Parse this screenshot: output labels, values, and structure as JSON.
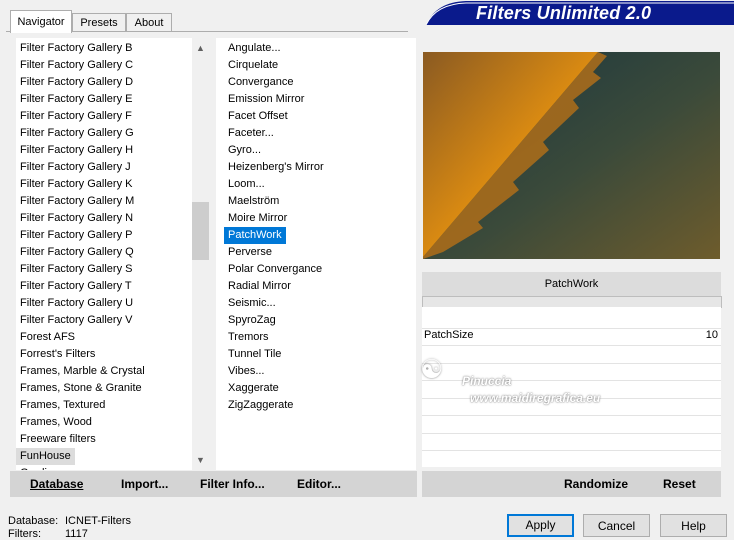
{
  "tabs": [
    "Navigator",
    "Presets",
    "About"
  ],
  "banner_title": "Filters Unlimited 2.0",
  "categories": [
    "Filter Factory Gallery B",
    "Filter Factory Gallery C",
    "Filter Factory Gallery D",
    "Filter Factory Gallery E",
    "Filter Factory Gallery F",
    "Filter Factory Gallery G",
    "Filter Factory Gallery H",
    "Filter Factory Gallery J",
    "Filter Factory Gallery K",
    "Filter Factory Gallery M",
    "Filter Factory Gallery N",
    "Filter Factory Gallery P",
    "Filter Factory Gallery Q",
    "Filter Factory Gallery S",
    "Filter Factory Gallery T",
    "Filter Factory Gallery U",
    "Filter Factory Gallery V",
    "Forest AFS",
    "Forrest's Filters",
    "Frames, Marble & Crystal",
    "Frames, Stone & Granite",
    "Frames, Textured",
    "Frames, Wood",
    "Freeware filters",
    "FunHouse",
    "Gradien"
  ],
  "selected_category": "FunHouse",
  "filters": [
    "Angulate...",
    "Cirquelate",
    "Convergance",
    "Emission Mirror",
    "Facet Offset",
    "Faceter...",
    "Gyro...",
    "Heizenberg's Mirror",
    "Loom...",
    "Maelström",
    "Moire Mirror",
    "PatchWork",
    "Perverse",
    "Polar Convergance",
    "Radial Mirror",
    "Seismic...",
    "SpyroZag",
    "Tremors",
    "Tunnel Tile",
    "Vibes...",
    "Xaggerate",
    "ZigZaggerate"
  ],
  "selected_filter": "PatchWork",
  "bottom_left_buttons": [
    "Database",
    "Import...",
    "Filter Info...",
    "Editor..."
  ],
  "bottom_right_buttons": [
    "Randomize",
    "Reset"
  ],
  "preview_filter_name": "PatchWork",
  "param": {
    "name": "PatchSize",
    "value": "10"
  },
  "watermark": {
    "line1": "Pinuccia",
    "line2": "www.maidiregrafica.eu"
  },
  "status": {
    "database_label": "Database:",
    "database_value": "ICNET-Filters",
    "filters_label": "Filters:",
    "filters_value": "1117"
  },
  "dialog_buttons": [
    "Apply",
    "Cancel",
    "Help"
  ],
  "colors": {
    "selection": "#0078d7",
    "orange": "#c97f1a",
    "teal": "#1e3c45",
    "olive": "#6b5a2e",
    "banner": "#0a1a8c"
  }
}
